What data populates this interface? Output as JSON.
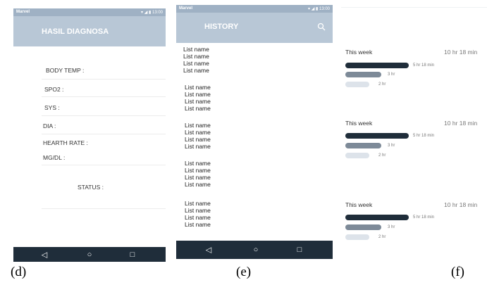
{
  "status_bar": {
    "carrier": "Marvel",
    "time": "13:00",
    "icons": "▾ ◢ ▮"
  },
  "panel_d": {
    "title": "HASIL DIAGNOSA",
    "fields": [
      "BODY TEMP :",
      "SPO2 :",
      "SYS :",
      "DIA :",
      "HEARTH RATE :",
      "MG/DL :"
    ],
    "status_label": "STATUS :",
    "caption": "(d)"
  },
  "panel_e": {
    "title": "HISTORY",
    "search_icon": "search-icon",
    "item_label": "List name",
    "groups": [
      [
        "List name",
        "List name",
        "List name",
        "List name"
      ],
      [
        "List name",
        "List name",
        "List name",
        "List name"
      ],
      [
        "List name",
        "List name",
        "List name",
        "List name"
      ],
      [
        "List name",
        "List name",
        "List name",
        "List name"
      ],
      [
        "List name",
        "List name",
        "List name",
        "List name"
      ]
    ],
    "caption": "(e)"
  },
  "navbar": {
    "back": "◁",
    "home": "○",
    "recent": "□"
  },
  "panel_f": {
    "sections": [
      {
        "title": "This week",
        "total": "10 hr 18 min",
        "bars": [
          {
            "label": "5 hr 18 min",
            "fraction": 1.0,
            "color": "#1f2d3a"
          },
          {
            "label": "3 hr",
            "fraction": 0.57,
            "color": "#7d8a98"
          },
          {
            "label": "2 hr",
            "fraction": 0.38,
            "color": "#dde3ea"
          }
        ]
      },
      {
        "title": "This week",
        "total": "10 hr 18 min",
        "bars": [
          {
            "label": "5 hr 18 min",
            "fraction": 1.0,
            "color": "#1f2d3a"
          },
          {
            "label": "3 hr",
            "fraction": 0.57,
            "color": "#7d8a98"
          },
          {
            "label": "2 hr",
            "fraction": 0.38,
            "color": "#dde3ea"
          }
        ]
      },
      {
        "title": "This week",
        "total": "10 hr 18 min",
        "bars": [
          {
            "label": "5 hr 18 min",
            "fraction": 1.0,
            "color": "#1f2d3a"
          },
          {
            "label": "3 hr",
            "fraction": 0.57,
            "color": "#7d8a98"
          },
          {
            "label": "2 hr",
            "fraction": 0.38,
            "color": "#dde3ea"
          }
        ]
      }
    ],
    "caption": "(f)"
  },
  "colors": {
    "appbar": "#b8c7d6",
    "status": "#9fb1c4",
    "navbar": "#1f2d3a"
  }
}
